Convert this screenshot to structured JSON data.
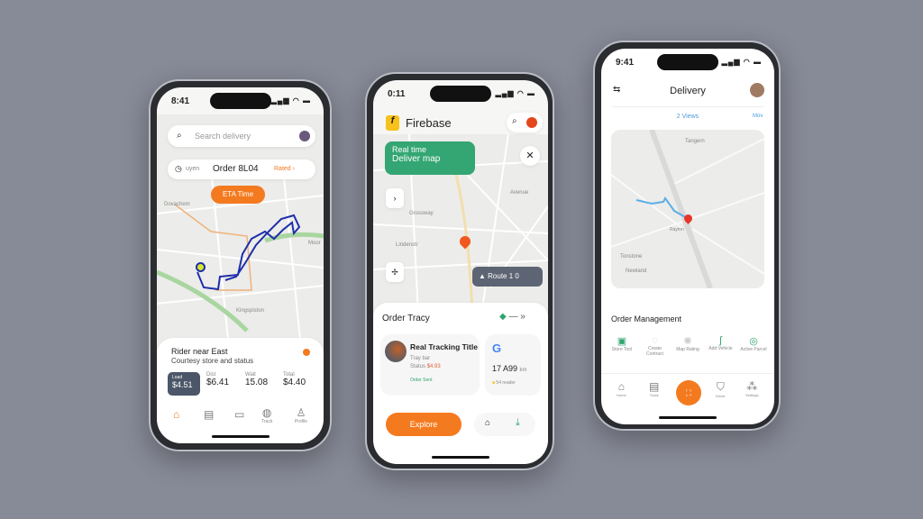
{
  "colors": {
    "accent": "#f47a1f",
    "green": "#2fa56f",
    "route": "#1e2fa8",
    "background": "#878a97"
  },
  "phone1": {
    "time": "8:41",
    "search_placeholder": "Search delivery",
    "order_bar": {
      "prefix": "uyen",
      "label": "Order 8L04",
      "action": "Rated ›"
    },
    "callout": "ETA Time",
    "map_labels": [
      "Dovachem",
      "Kingspiston",
      "Moor"
    ],
    "sheet": {
      "title": "Rider near East",
      "subtitle": "Courtesy store and status"
    },
    "stats": [
      {
        "label": "Load",
        "value": "$4.51"
      },
      {
        "label": "Dist",
        "value": "$6.41"
      },
      {
        "label": "Wait",
        "value": "15.08"
      },
      {
        "label": "Total",
        "value": "$4.40"
      }
    ],
    "nav": [
      {
        "icon": "home-icon",
        "label": "Home"
      },
      {
        "icon": "box-icon",
        "label": "Orders"
      },
      {
        "icon": "wallet-icon",
        "label": "Wallet"
      },
      {
        "icon": "globe-icon",
        "label": "Track"
      },
      {
        "icon": "user-icon",
        "label": "Profile"
      }
    ]
  },
  "phone2": {
    "time": "0:11",
    "app_name": "Firebase",
    "callout_line1": "Real time",
    "callout_line2": "Deliver map",
    "map_labels": [
      "Avenue",
      "Grossway",
      "Lindenstr"
    ],
    "status_chip": "Route 1 0",
    "section_title": "Order Tracy",
    "order_card": {
      "title": "Real Tracking Title",
      "line1": "Tray bar",
      "line2_label": "Status",
      "line2_value": "$4.93",
      "tag": "Order Sent"
    },
    "side_card": {
      "value": "17 A99",
      "unit": "km",
      "note": "54 reader"
    },
    "primary_button": "Explore"
  },
  "phone3": {
    "time": "9:41",
    "title": "Delivery",
    "tab_center": "2 Views",
    "tab_right": "Mov",
    "map_labels": [
      "Tangern",
      "Rayton",
      "Tonstone",
      "Newland"
    ],
    "section_title": "Order Management",
    "actions": [
      {
        "icon": "store-icon",
        "label": "Store Tool"
      },
      {
        "icon": "chat-icon",
        "label": "Create Contract"
      },
      {
        "icon": "refresh-icon",
        "label": "Map Rating"
      },
      {
        "icon": "pin-icon",
        "label": "Add Vehicle"
      },
      {
        "icon": "check-icon",
        "label": "Active Parcel"
      }
    ],
    "nav": [
      {
        "icon": "home-icon",
        "label": "Home"
      },
      {
        "icon": "list-icon",
        "label": "Track"
      },
      {
        "icon": "scan-icon",
        "label": ""
      },
      {
        "icon": "shield-icon",
        "label": "Driver"
      },
      {
        "icon": "settings-icon",
        "label": "Settings"
      }
    ]
  }
}
